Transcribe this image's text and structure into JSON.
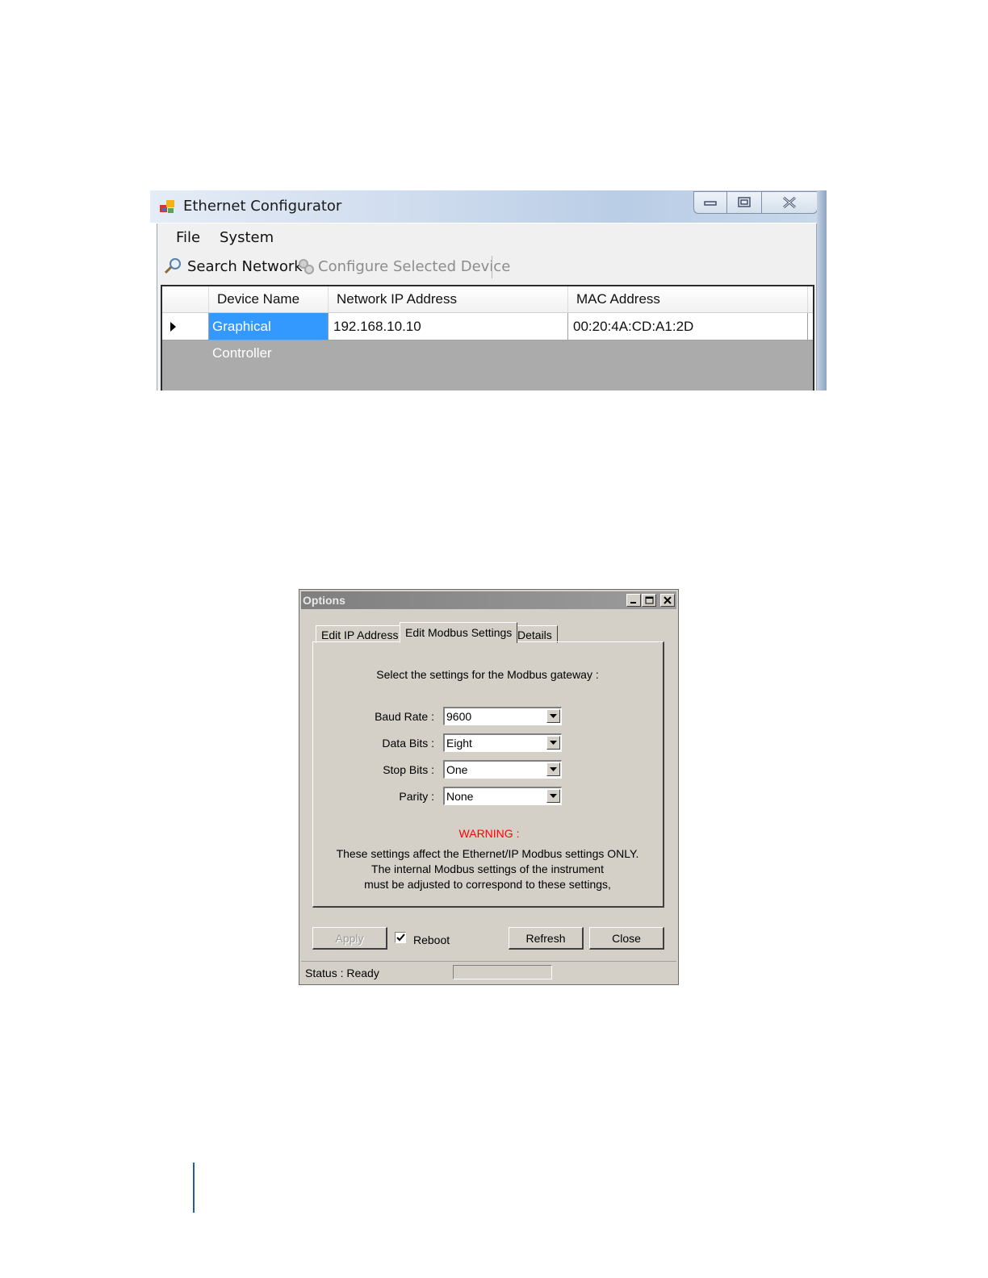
{
  "ethernet_window": {
    "title": "Ethernet Configurator",
    "menu": [
      "File",
      "System"
    ],
    "toolbar": {
      "search_label": "Search Network",
      "configure_label": "Configure Selected Device"
    },
    "grid": {
      "columns": [
        "Device Name",
        "Network IP Address",
        "MAC Address"
      ],
      "rows": [
        {
          "device_name": "Graphical Controller",
          "ip": "192.168.10.10",
          "mac": "00:20:4A:CD:A1:2D"
        }
      ]
    }
  },
  "options_dialog": {
    "title": "Options",
    "tabs": [
      "Edit IP Address",
      "Edit Modbus Settings",
      "Details"
    ],
    "active_tab": "Edit Modbus Settings",
    "intro": "Select the settings for the Modbus gateway :",
    "fields": [
      {
        "label": "Baud Rate :",
        "value": "9600"
      },
      {
        "label": "Data Bits :",
        "value": "Eight"
      },
      {
        "label": "Stop Bits :",
        "value": "One"
      },
      {
        "label": "Parity :",
        "value": "None"
      }
    ],
    "warning_title": "WARNING :",
    "warning_lines": [
      "These settings affect the Ethernet/IP Modbus settings ONLY.",
      "The internal Modbus settings of the instrument",
      "must be adjusted to correspond to these settings,"
    ],
    "buttons": {
      "apply": "Apply",
      "refresh": "Refresh",
      "close": "Close"
    },
    "reboot_label": "Reboot",
    "reboot_checked": true,
    "status": "Status : Ready"
  },
  "colors": {
    "selection": "#3399ff",
    "warning": "#ff0000",
    "dialog_face": "#d4d0c8",
    "page_rule": "#1f5fa8"
  },
  "icons": [
    "app-icon",
    "minimize-icon",
    "maximize-icon",
    "close-icon",
    "search-icon",
    "configure-icon",
    "row-pointer-icon",
    "dropdown-arrow-icon",
    "checkmark-icon"
  ]
}
